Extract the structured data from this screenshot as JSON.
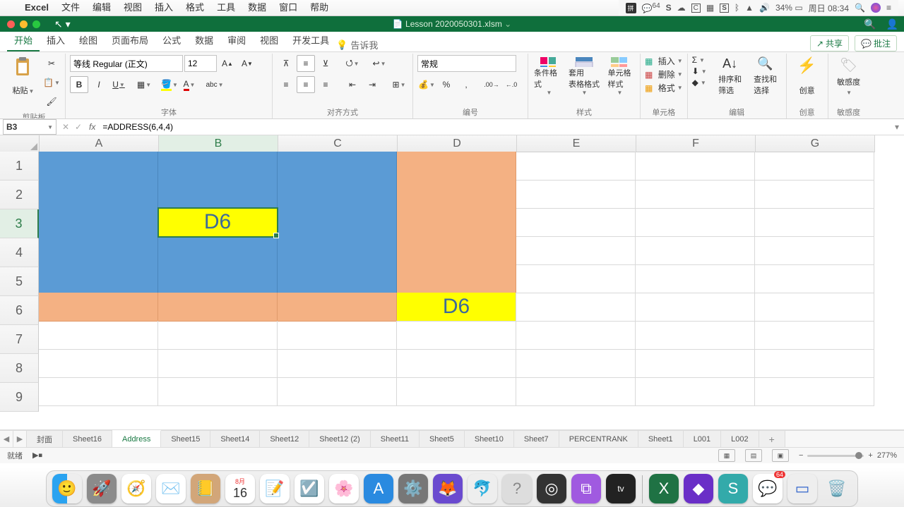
{
  "menubar": {
    "app": "Excel",
    "items": [
      "文件",
      "编辑",
      "视图",
      "插入",
      "格式",
      "工具",
      "数据",
      "窗口",
      "帮助"
    ],
    "wechat_badge": "64",
    "battery": "34%",
    "clock": "周日 08:34"
  },
  "window": {
    "title": "Lesson 2020050301.xlsm"
  },
  "tabs": {
    "items": [
      "开始",
      "插入",
      "绘图",
      "页面布局",
      "公式",
      "数据",
      "审阅",
      "视图",
      "开发工具"
    ],
    "active": 0,
    "tellme": "告诉我",
    "share": "共享",
    "comments": "批注"
  },
  "ribbon": {
    "clipboard": {
      "paste": "粘贴",
      "label": "剪贴板"
    },
    "font": {
      "name": "等线 Regular (正文)",
      "size": "12",
      "label": "字体"
    },
    "align": {
      "label": "对齐方式"
    },
    "number": {
      "format": "常规",
      "label": "编号"
    },
    "styles": {
      "cf": "条件格式",
      "tbl": "套用\n表格格式",
      "cell": "单元格\n样式",
      "label": "样式"
    },
    "cells": {
      "insert": "插入",
      "delete": "删除",
      "format": "格式",
      "label": "单元格"
    },
    "editing": {
      "sort": "排序和\n筛选",
      "find": "查找和\n选择",
      "label": "编辑"
    },
    "ideas": {
      "label": "创意",
      "btn": "创意"
    },
    "sens": {
      "label": "敏感度",
      "btn": "敏感度"
    }
  },
  "fx": {
    "name": "B3",
    "formula": "=ADDRESS(6,4,4)"
  },
  "sheet": {
    "cols": [
      "A",
      "B",
      "C",
      "D",
      "E",
      "F",
      "G"
    ],
    "rows": [
      "1",
      "2",
      "3",
      "4",
      "5",
      "6",
      "7",
      "8",
      "9"
    ],
    "sel_col": 1,
    "sel_row": 2,
    "b3": "D6",
    "d6": "D6"
  },
  "sheets": {
    "items": [
      "封面",
      "Sheet16",
      "Address",
      "Sheet15",
      "Sheet14",
      "Sheet12",
      "Sheet12 (2)",
      "Sheet11",
      "Sheet5",
      "Sheet10",
      "Sheet7",
      "PERCENTRANK",
      "Sheet1",
      "L001",
      "L002"
    ],
    "active": 2
  },
  "statusbar": {
    "ready": "就绪",
    "zoom": "277%"
  },
  "dock": {
    "icons": [
      "finder",
      "launchpad",
      "safari",
      "mail",
      "contacts",
      "calendar",
      "notes",
      "reminders",
      "photos",
      "appstore",
      "settings",
      "firefox",
      "mysql",
      "help",
      "obs",
      "podcasts",
      "appletv",
      "excel",
      "wondershare",
      "snagit",
      "wechat",
      "vm",
      "trash"
    ],
    "cal_month": "8月",
    "cal_day": "16",
    "wechat_badge": "64"
  }
}
